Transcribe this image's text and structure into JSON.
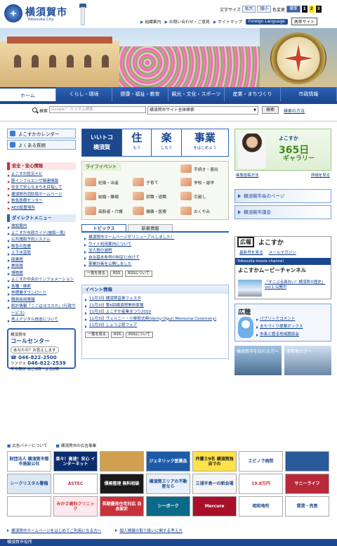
{
  "header": {
    "city_name": "横須賀市",
    "city_en": "Yokosuka City",
    "textsize_label": "文字サイズ",
    "enlarge": "拡大",
    "shrink": "縮小",
    "color_label": "色変更",
    "standard": "標準",
    "color1": "1",
    "color2": "2",
    "color3": "3",
    "links": [
      "組織案内",
      "お問い合わせ・ご意見",
      "サイトマップ"
    ],
    "foreign": "Foreign Language",
    "mobile": "携帯サイト"
  },
  "nav": {
    "tabs": [
      "ホーム",
      "くらし・環境",
      "健康・福祉・教育",
      "観光・文化・スポーツ",
      "産業・まちづくり",
      "市政情報"
    ]
  },
  "search": {
    "label": "検索",
    "placeholder": "Google™ カスタム検索",
    "scope": "横須賀市サイト全体検索",
    "button": "検索",
    "help": "検索の方法"
  },
  "left": {
    "calendar": "よこすかカレンダー",
    "faq": "よくある質問",
    "safety_head": "安全・安心情報",
    "safety_items": [
      "よこすか防災ナビ",
      "豚インフルエンザ関連情報",
      "安全で安心なまちを目指して",
      "横須賀市消防局ホームページ",
      "救急医療センター",
      "AED設置場所"
    ],
    "direct_head": "ダイレクトメニュー",
    "direct_items": [
      "施設案内",
      "よこすか市政ガイド(施設一覧)",
      "公共施設予約システム",
      "救急の医療",
      "上下水道局",
      "図書館",
      "美術館",
      "博物館",
      "よこすか中央のインフォメーション",
      "各種・検索",
      "申請書ダウンロード",
      "職員採用情報",
      "統計情報「ここはヨコスカ」(行政サービス)",
      "地上デジタル放送について"
    ],
    "call_name": "横須賀市",
    "call_title": "コールセンター",
    "call_note": "あなたの？お答えします",
    "tel": "046-822-2500",
    "fax_label": "ファクス",
    "fax": "046-822-2539",
    "hours": "年中無休 あさ8時〜よる8時"
  },
  "center": {
    "catch_line1": "いいトコ",
    "catch_line2": "横須賀",
    "catch_words": [
      {
        "big": "住",
        "sm": "もう"
      },
      {
        "big": "楽",
        "sm": "しもう"
      },
      {
        "big": "事業",
        "sm": "をはじめよう"
      }
    ],
    "life_head": "ライフイベント",
    "life_items": [
      "手続き・届出",
      "妊娠・出産",
      "子育て",
      "学校・進学",
      "結婚・離婚",
      "就職・退職",
      "引越し",
      "高齢者・介護",
      "健康・医療",
      "おくやみ"
    ],
    "tabs": [
      "トピックス",
      "新着情報"
    ],
    "topics": [
      "横須賀市ホームページがリニューアルしました！",
      "サイト利用案内について",
      "法人税の減税",
      "自治基本条例の制定に向けて",
      "事業計画を公開しました"
    ],
    "btn_list": "一覧を見る",
    "btn_rss": "RSS",
    "btn_rss_about": "RSSについて",
    "events_head": "イベント情報",
    "events": [
      "11月3日 横須賀音楽フェスタ",
      "11月3日 第6回横須賀美術家展",
      "11月3日 よこすか産業まつり2010",
      "11月3日 ヴェルニー・小栗祭式典(Verny-Oguri Memorial Ceremony)",
      "11月3日 しょうぶ祭フェア"
    ]
  },
  "right": {
    "gallery_t1": "よこすか",
    "gallery_t2": "365日",
    "gallery_t3": "ギャラリー",
    "gallery_link1": "画像投稿方法",
    "gallery_link2": "詳細を見る",
    "mayor": "横須賀市長のページ",
    "council": "横須賀市議会",
    "kouhou_label": "広報",
    "kouhou_name": "よこすか",
    "kouhou_link1": "最新号を見る",
    "kouhou_link2": "メールマガジン",
    "movie_channel_en": "Yokosuka movie channel",
    "movie_channel": "よこすかムービーチャンネル",
    "movie_desc": "「すこぶる面白い！横須賀の歴史」vol.1 公開中",
    "kouchou": "広聴",
    "kouchou_items": [
      "パブリックコメント",
      "まちづくり提案ボックス",
      "市長と語る地域懇談会"
    ],
    "visit1": "横須賀市を訪れる方へ",
    "visit2": "事業者の方へ"
  },
  "ads": {
    "head1": "広告バナーについて",
    "head2": "横須賀市の広告事業",
    "items": [
      {
        "text": "財団法人 横須賀市都市施設公社",
        "bg": "#ffffff",
        "fg": "#1c4890"
      },
      {
        "text": "楽々！高速！安心 インターネット",
        "bg": "#0b2d6e",
        "fg": "#ffffff"
      },
      {
        "text": "",
        "bg": "#d0a050",
        "fg": "#ffffff"
      },
      {
        "text": "ジェネリック医薬品",
        "bg": "#1d5ba8",
        "fg": "#ffffff"
      },
      {
        "text": "弁護士9名 横須賀独自での",
        "bg": "#ffe14a",
        "fg": "#1a1a1a"
      },
      {
        "text": "エビノラ病院",
        "bg": "#ffffff",
        "fg": "#1c4890"
      },
      {
        "text": "",
        "bg": "#2a5a9a",
        "fg": "#ffffff"
      },
      {
        "text": "シークリスタル警備",
        "bg": "#dde8f5",
        "fg": "#1c4890"
      },
      {
        "text": "ASTEC",
        "bg": "#ffffff",
        "fg": "#c8323a"
      },
      {
        "text": "債務整理 無料相談",
        "bg": "#1a1a1a",
        "fg": "#ffffff"
      },
      {
        "text": "横須賀エリアの不動産なら",
        "bg": "#e8f0fb",
        "fg": "#1c4890"
      },
      {
        "text": "三浦半島一の新会場",
        "bg": "#f5f5f5",
        "fg": "#1c4890"
      },
      {
        "text": "19.8万円",
        "bg": "#ffffff",
        "fg": "#c8323a"
      },
      {
        "text": "サニーライフ",
        "bg": "#b82a3a",
        "fg": "#ffffff"
      },
      {
        "text": "",
        "bg": "#ffffff",
        "fg": "#1c4890"
      },
      {
        "text": "みかさ歯科クリニック",
        "bg": "#ffe8ee",
        "fg": "#c8323a"
      },
      {
        "text": "長期優良住宅対応 自由設計",
        "bg": "#c8323a",
        "fg": "#ffffff"
      },
      {
        "text": "シーボーク",
        "bg": "#0b6a8a",
        "fg": "#ffffff"
      },
      {
        "text": "Mercure",
        "bg": "#a8102a",
        "fg": "#ffffff"
      },
      {
        "text": "相和地所",
        "bg": "#ffffff",
        "fg": "#1c4890"
      },
      {
        "text": "賃貸・売買",
        "bg": "#ffffff",
        "fg": "#1c4890"
      }
    ]
  },
  "foot": {
    "link1": "横須賀市ホームページをはじめてご利用になる方へ",
    "link2": "個人情報の取り扱いに関する考え方",
    "bottom": "横須賀市役所"
  },
  "colors": {
    "brand": "#1c4890",
    "accent": "#c8323a"
  }
}
